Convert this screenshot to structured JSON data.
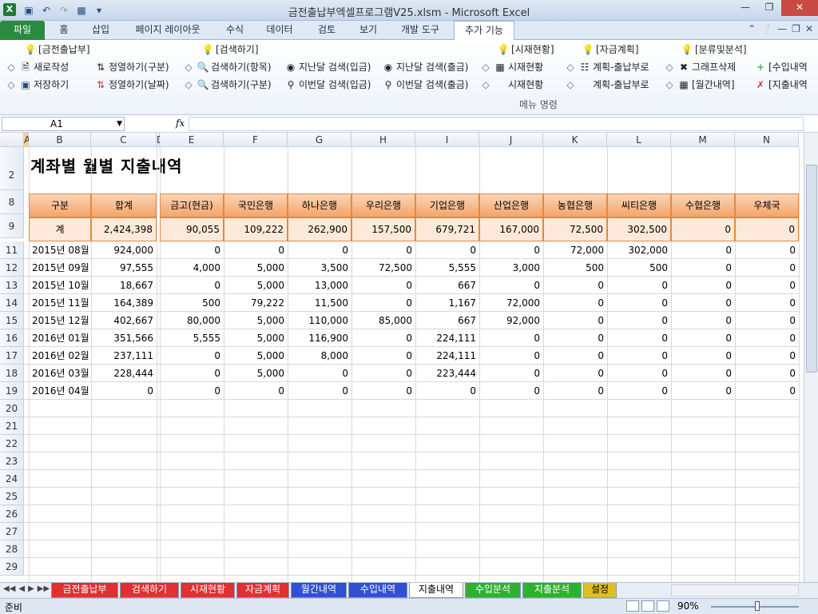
{
  "window": {
    "title": "금전출납부엑셀프로그램V25.xlsm  -  Microsoft Excel",
    "app_icon": "X"
  },
  "ribbon_tabs": [
    "파일",
    "홈",
    "삽입",
    "페이지 레이아웃",
    "수식",
    "데이터",
    "검토",
    "보기",
    "개발 도구",
    "추가 기능"
  ],
  "ribbon": {
    "items_row1": [
      {
        "label": "[금전출납부]",
        "icon": "bulb-red-icon"
      },
      {
        "label": "[검색하기]",
        "icon": "bulb-red-icon"
      },
      {
        "label": "[시재현황]",
        "icon": "bulb-red-icon"
      },
      {
        "label": "[자금계획]",
        "icon": "bulb-yellow-icon"
      },
      {
        "label": "[분류및분석]",
        "icon": "bulb-red-icon"
      }
    ],
    "items_row2": [
      {
        "label": "새로작성"
      },
      {
        "label": "정열하기(구분)"
      },
      {
        "label": "검색하기(항목)"
      },
      {
        "label": "지난달 검색(입금)"
      },
      {
        "label": "지난달 검색(출금)"
      },
      {
        "label": "시재현황"
      },
      {
        "label": "계획-출납부로"
      },
      {
        "label": "그래프삭제"
      },
      {
        "label": "[수입내역"
      }
    ],
    "items_row3": [
      {
        "label": "저장하기"
      },
      {
        "label": "정열하기(날짜)"
      },
      {
        "label": "검색하기(구분)"
      },
      {
        "label": "이번달 검색(입금)"
      },
      {
        "label": "이번달 검색(출금)"
      },
      {
        "label": "시재현황"
      },
      {
        "label": "계획-출납부로"
      },
      {
        "label": "[월간내역]"
      },
      {
        "label": "[지출내역"
      }
    ],
    "group_label": "메뉴 명령"
  },
  "formula_bar": {
    "name_box": "A1",
    "fx": "fx",
    "formula": ""
  },
  "columns": [
    "A",
    "B",
    "C",
    "D",
    "E",
    "F",
    "G",
    "H",
    "I",
    "J",
    "K",
    "L",
    "M",
    "N"
  ],
  "sheet": {
    "title": "계좌별 월별 지출내역",
    "headers": [
      "구분",
      "합계",
      "금고(현금)",
      "국민은행",
      "하나은행",
      "우리은행",
      "기업은행",
      "산업은행",
      "농협은행",
      "씨티은행",
      "수협은행",
      "우체국"
    ],
    "total_row": [
      "계",
      "2,424,398",
      "90,055",
      "109,222",
      "262,900",
      "157,500",
      "679,721",
      "167,000",
      "72,500",
      "302,500",
      "0",
      "0"
    ],
    "rows": [
      [
        "2015년 08월",
        "924,000",
        "0",
        "0",
        "0",
        "0",
        "0",
        "0",
        "72,000",
        "302,000",
        "0",
        "0"
      ],
      [
        "2015년 09월",
        "97,555",
        "4,000",
        "5,000",
        "3,500",
        "72,500",
        "5,555",
        "3,000",
        "500",
        "500",
        "0",
        "0"
      ],
      [
        "2015년 10월",
        "18,667",
        "0",
        "5,000",
        "13,000",
        "0",
        "667",
        "0",
        "0",
        "0",
        "0",
        "0"
      ],
      [
        "2015년 11월",
        "164,389",
        "500",
        "79,222",
        "11,500",
        "0",
        "1,167",
        "72,000",
        "0",
        "0",
        "0",
        "0"
      ],
      [
        "2015년 12월",
        "402,667",
        "80,000",
        "5,000",
        "110,000",
        "85,000",
        "667",
        "92,000",
        "0",
        "0",
        "0",
        "0"
      ],
      [
        "2016년 01월",
        "351,566",
        "5,555",
        "5,000",
        "116,900",
        "0",
        "224,111",
        "0",
        "0",
        "0",
        "0",
        "0"
      ],
      [
        "2016년 02월",
        "237,111",
        "0",
        "5,000",
        "8,000",
        "0",
        "224,111",
        "0",
        "0",
        "0",
        "0",
        "0"
      ],
      [
        "2016년 03월",
        "228,444",
        "0",
        "5,000",
        "0",
        "0",
        "223,444",
        "0",
        "0",
        "0",
        "0",
        "0"
      ],
      [
        "2016년 04월",
        "0",
        "0",
        "0",
        "0",
        "0",
        "0",
        "0",
        "0",
        "0",
        "0",
        "0"
      ]
    ],
    "row_numbers": [
      "2",
      "8",
      "9",
      "11",
      "12",
      "13",
      "14",
      "15",
      "16",
      "17",
      "18",
      "19",
      "20",
      "21",
      "22",
      "23",
      "24",
      "25",
      "26",
      "27",
      "28",
      "29"
    ]
  },
  "sheet_tabs": [
    "금전출납부",
    "검색하기",
    "시재현황",
    "자금계획",
    "월간내역",
    "수입내역",
    "지출내역",
    "수입분석",
    "지출분석",
    "설정"
  ],
  "active_sheet_tab": "지출내역",
  "sheet_tab_colors": [
    "#e03030",
    "#e03030",
    "#e03030",
    "#e03030",
    "#3050d0",
    "#3050d0",
    "#ffffff",
    "#30b030",
    "#30b030",
    "#e0c020"
  ],
  "status": {
    "ready": "준비",
    "zoom": "90%"
  }
}
